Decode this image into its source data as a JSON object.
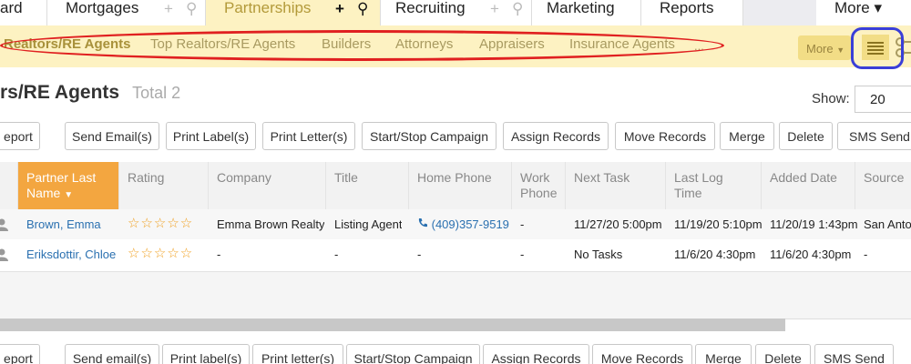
{
  "topnav": {
    "tabs": [
      {
        "label": "ard"
      },
      {
        "label": "Mortgages"
      },
      {
        "label": "Partnerships"
      },
      {
        "label": "Recruiting"
      },
      {
        "label": "Marketing"
      },
      {
        "label": "Reports"
      },
      {
        "label": "More ▾"
      }
    ]
  },
  "subnav": {
    "items": [
      {
        "label": "Realtors/RE Agents"
      },
      {
        "label": "Top Realtors/RE Agents"
      },
      {
        "label": "Builders"
      },
      {
        "label": "Attorneys"
      },
      {
        "label": "Appraisers"
      },
      {
        "label": "Insurance Agents"
      },
      {
        "label": "..."
      }
    ],
    "more_label": "More"
  },
  "header": {
    "title": "rs/RE Agents",
    "total": "Total 2",
    "show_label": "Show:",
    "show_value": "20"
  },
  "actions_top": [
    "eport",
    "Send Email(s)",
    "Print Label(s)",
    "Print Letter(s)",
    "Start/Stop Campaign",
    "Assign Records",
    "Move Records",
    "Merge",
    "Delete",
    "SMS Send"
  ],
  "actions_bottom": [
    "eport",
    "Send email(s)",
    "Print label(s)",
    "Print letter(s)",
    "Start/Stop Campaign",
    "Assign Records",
    "Move Records",
    "Merge",
    "Delete",
    "SMS Send"
  ],
  "table": {
    "columns": [
      "Partner Last Name",
      "Rating",
      "Company",
      "Title",
      "Home Phone",
      "Work Phone",
      "Next Task",
      "Last Log Time",
      "Added Date",
      "Source"
    ],
    "rows": [
      {
        "name": "Brown, Emma",
        "rating": "☆☆☆☆☆",
        "company": "Emma Brown Realty",
        "title": "Listing Agent",
        "home_phone": "(409)357-9519",
        "work_phone": "-",
        "next_task": "11/27/20 5:00pm",
        "last_log": "11/19/20 5:10pm",
        "added": "11/20/19 1:43pm",
        "source": "San Anto"
      },
      {
        "name": "Eriksdottir, Chloe",
        "rating": "☆☆☆☆☆",
        "company": "-",
        "title": "-",
        "home_phone": "-",
        "work_phone": "-",
        "next_task": "No Tasks",
        "last_log": "11/6/20 4:30pm",
        "added": "11/6/20 4:30pm",
        "source": "-"
      }
    ]
  },
  "colors": {
    "accent": "#f3a640",
    "subnav_bg": "#fdf2c2",
    "link": "#2a70b0",
    "annotation_red": "#e02020",
    "annotation_blue": "#3a3fd8"
  }
}
